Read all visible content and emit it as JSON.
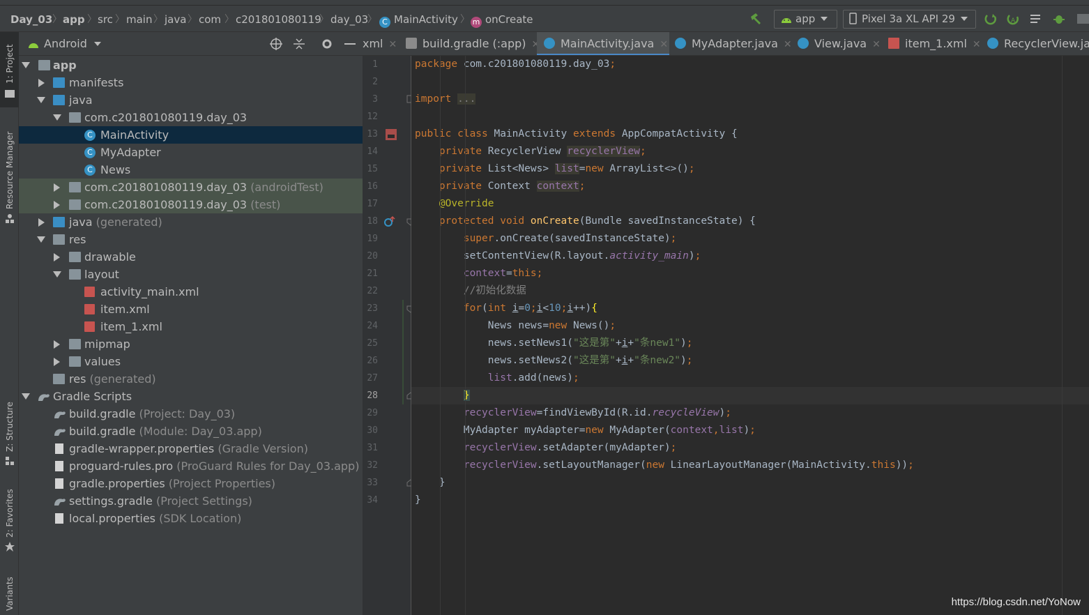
{
  "breadcrumbs": [
    "Day_03",
    "app",
    "src",
    "main",
    "java",
    "com",
    "c201801080119",
    "day_03",
    "MainActivity",
    "onCreate"
  ],
  "toolbar": {
    "run_config": "app",
    "device": "Pixel 3a XL API 29",
    "icons": [
      "hammer-icon",
      "android-icon",
      "phone-icon",
      "apply-changes-icon",
      "apply-code-changes-icon",
      "sync-icon",
      "debug-icon"
    ]
  },
  "left_strip": {
    "tabs": [
      "1: Project",
      "Resource Manager",
      "Z: Structure",
      "2: Favorites",
      "Variants"
    ]
  },
  "project_panel": {
    "view_mode": "Android",
    "tree": [
      {
        "label": "app",
        "sub": ""
      },
      {
        "label": "manifests",
        "sub": ""
      },
      {
        "label": "java",
        "sub": ""
      },
      {
        "label": "com.c201801080119.day_03",
        "sub": ""
      },
      {
        "label": "MainActivity",
        "sub": ""
      },
      {
        "label": "MyAdapter",
        "sub": ""
      },
      {
        "label": "News",
        "sub": ""
      },
      {
        "label": "com.c201801080119.day_03",
        "sub": "(androidTest)"
      },
      {
        "label": "com.c201801080119.day_03",
        "sub": "(test)"
      },
      {
        "label": "java",
        "sub": "(generated)"
      },
      {
        "label": "res",
        "sub": ""
      },
      {
        "label": "drawable",
        "sub": ""
      },
      {
        "label": "layout",
        "sub": ""
      },
      {
        "label": "activity_main.xml",
        "sub": ""
      },
      {
        "label": "item.xml",
        "sub": ""
      },
      {
        "label": "item_1.xml",
        "sub": ""
      },
      {
        "label": "mipmap",
        "sub": ""
      },
      {
        "label": "values",
        "sub": ""
      },
      {
        "label": "res",
        "sub": "(generated)"
      },
      {
        "label": "Gradle Scripts",
        "sub": ""
      },
      {
        "label": "build.gradle",
        "sub": "(Project: Day_03)"
      },
      {
        "label": "build.gradle",
        "sub": "(Module: Day_03.app)"
      },
      {
        "label": "gradle-wrapper.properties",
        "sub": "(Gradle Version)"
      },
      {
        "label": "proguard-rules.pro",
        "sub": "(ProGuard Rules for Day_03.app)"
      },
      {
        "label": "gradle.properties",
        "sub": "(Project Properties)"
      },
      {
        "label": "settings.gradle",
        "sub": "(Project Settings)"
      },
      {
        "label": "local.properties",
        "sub": "(SDK Location)"
      }
    ]
  },
  "editor_tabs": [
    {
      "label": "xml"
    },
    {
      "label": "build.gradle (:app)"
    },
    {
      "label": "MainActivity.java"
    },
    {
      "label": "MyAdapter.java"
    },
    {
      "label": "View.java"
    },
    {
      "label": "item_1.xml"
    },
    {
      "label": "RecyclerView.jav"
    }
  ],
  "editor": {
    "line_numbers": [
      "1",
      "2",
      "3",
      "12",
      "13",
      "14",
      "15",
      "16",
      "17",
      "18",
      "19",
      "20",
      "21",
      "22",
      "23",
      "24",
      "25",
      "26",
      "27",
      "28",
      "29",
      "30",
      "31",
      "32",
      "33",
      "34"
    ],
    "current_line": "28"
  },
  "watermark": "https://blog.csdn.net/YoNow"
}
